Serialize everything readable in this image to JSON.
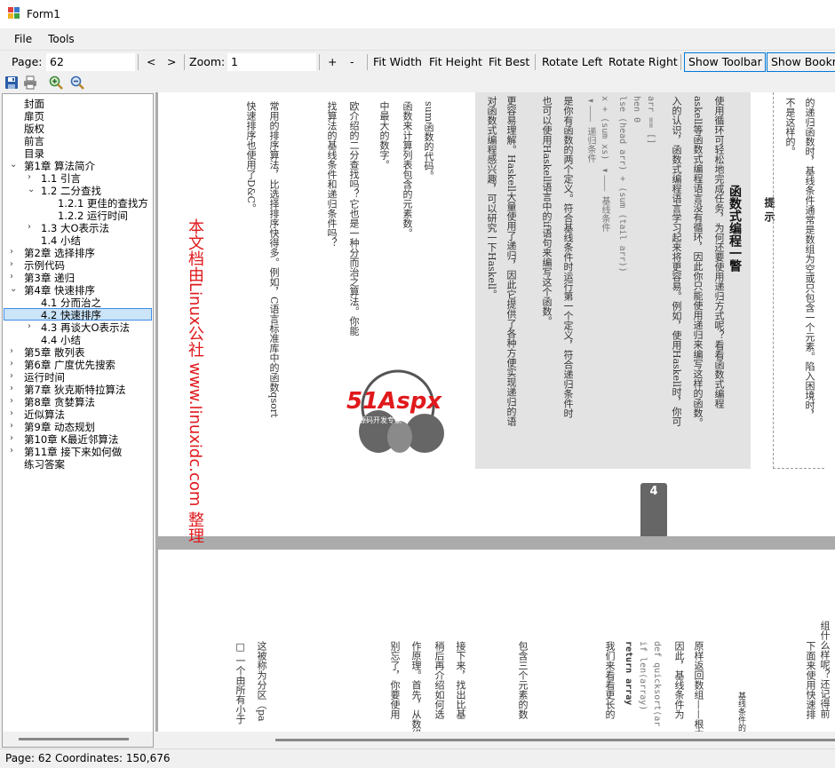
{
  "window": {
    "title": "Form1"
  },
  "menu": {
    "file": "File",
    "tools": "Tools"
  },
  "nav": {
    "page_label": "Page:",
    "page_value": "62",
    "prev": "<",
    "next": ">",
    "zoom_label": "Zoom:",
    "zoom_value": "1",
    "zoom_in": "+",
    "zoom_out": "-",
    "fit_width": "Fit Width",
    "fit_height": "Fit Height",
    "fit_best": "Fit Best",
    "rotate_left": "Rotate Left",
    "rotate_right": "Rotate Right",
    "show_toolbar": "Show Toolbar",
    "show_bookmarks": "Show Bookm"
  },
  "toolbar_icons": [
    "save-icon",
    "print-icon",
    "zoom-in-icon",
    "zoom-out-icon"
  ],
  "bookmarks": [
    {
      "label": "封面"
    },
    {
      "label": "扉页"
    },
    {
      "label": "版权"
    },
    {
      "label": "前言"
    },
    {
      "label": "目录"
    },
    {
      "label": "第1章  算法简介",
      "arrow": "⌄"
    },
    {
      "label": "1.1  引言",
      "arrow": "›"
    },
    {
      "label": "1.2  二分查找",
      "arrow": "⌄"
    },
    {
      "label": "1.2.1  更佳的查找方"
    },
    {
      "label": "1.2.2  运行时间"
    },
    {
      "label": "1.3  大O表示法",
      "arrow": "›"
    },
    {
      "label": "1.4  小结"
    },
    {
      "label": "第2章  选择排序",
      "arrow": "›"
    },
    {
      "label": "示例代码",
      "arrow": "›"
    },
    {
      "label": "第3章  递归",
      "arrow": "›"
    },
    {
      "label": "第4章  快速排序",
      "arrow": "⌄"
    },
    {
      "label": "4.1  分而治之"
    },
    {
      "label": "4.2  快速排序",
      "selected": true
    },
    {
      "label": "4.3  再谈大O表示法",
      "arrow": "›"
    },
    {
      "label": "4.4  小结"
    },
    {
      "label": "第5章  散列表",
      "arrow": "›"
    },
    {
      "label": "第6章  广度优先搜索",
      "arrow": "›"
    },
    {
      "label": "运行时间",
      "arrow": "›"
    },
    {
      "label": "第7章  狄克斯特拉算法",
      "arrow": "›"
    },
    {
      "label": "第8章  贪婪算法",
      "arrow": "›"
    },
    {
      "label": "近似算法",
      "arrow": "›"
    },
    {
      "label": "第9章  动态规划",
      "arrow": "›"
    },
    {
      "label": "第10章  K最近邻算法",
      "arrow": "›"
    },
    {
      "label": "第11章  接下来如何做",
      "arrow": "›"
    },
    {
      "label": "练习答案"
    }
  ],
  "document": {
    "watermark": "本文档由Linux公社 www.linuxidc.com 整理",
    "page_tab": "4",
    "logo_text": "51Aspx",
    "logo_sub": "源码开发专家",
    "box_title": "函数式编程一瞥",
    "box_hint": "提    示",
    "box_lines": [
      "使用循环可轻松地完成任务，为何还要使用递归方式呢？看看函数式编程",
      "askell等函数式编程语言没有循环，因此你只能使用递归来编写这样的函数。",
      "入的认识，函数式编程语言学习起来将更容易。例如，使用Haskell时，你可",
      "arr == []",
      "hen 0",
      "lse (head arr) + (sum (tail arr))",
      "x + (sum xs)   ◄——— 基线条件",
      "                ◄——— 递归条件",
      "是你有函数的两个定义。符合基线条件时运行第一个定义，符合递归条件时",
      "也可以使用Haskell语言中的if语句来编写这个函数。",
      "更容易理解。Haskell大量使用了递归，因此它提供了各种方便实现递归的语",
      "对函数式编程感兴趣，可以研究一下Haskell。"
    ],
    "left_lines": [
      "快速排序也使用了D&C。",
      "常用的排序算法，比选择排序快得多。例如，C语言标准库中的函数qsort",
      "找算法的基线条件和递归条件吗？",
      "欧介绍的二分查找吗？它也是一种分而治之算法。你能",
      "中最大的数字。",
      "函数来计算列表包含的元素数。",
      "sum函数的代码。"
    ],
    "right_lines": [
      "的递归函数时，基线条件通常是数组为空或只包含一个元素。陷入困境时，",
      "不是这样的。"
    ],
    "page2_lines": [
      "组什么样呢？还记得前",
      "下面来使用快速排",
      "基线条件的",
      "原样返回数组——根本",
      "因此，基线条件为",
      "def quicksort(ar",
      "  if len(array)",
      "    return array",
      "我们来看看更长的",
      "包含三个元素的数",
      "接下来，找出比基",
      "稍后再介绍如何选",
      "作原理。首先，从数组",
      "别忘了，你要使用",
      "这被称为分区（pa",
      "□ 一个由所有小于"
    ]
  },
  "status": {
    "text": "Page: 62  Coordinates: 150,676"
  }
}
